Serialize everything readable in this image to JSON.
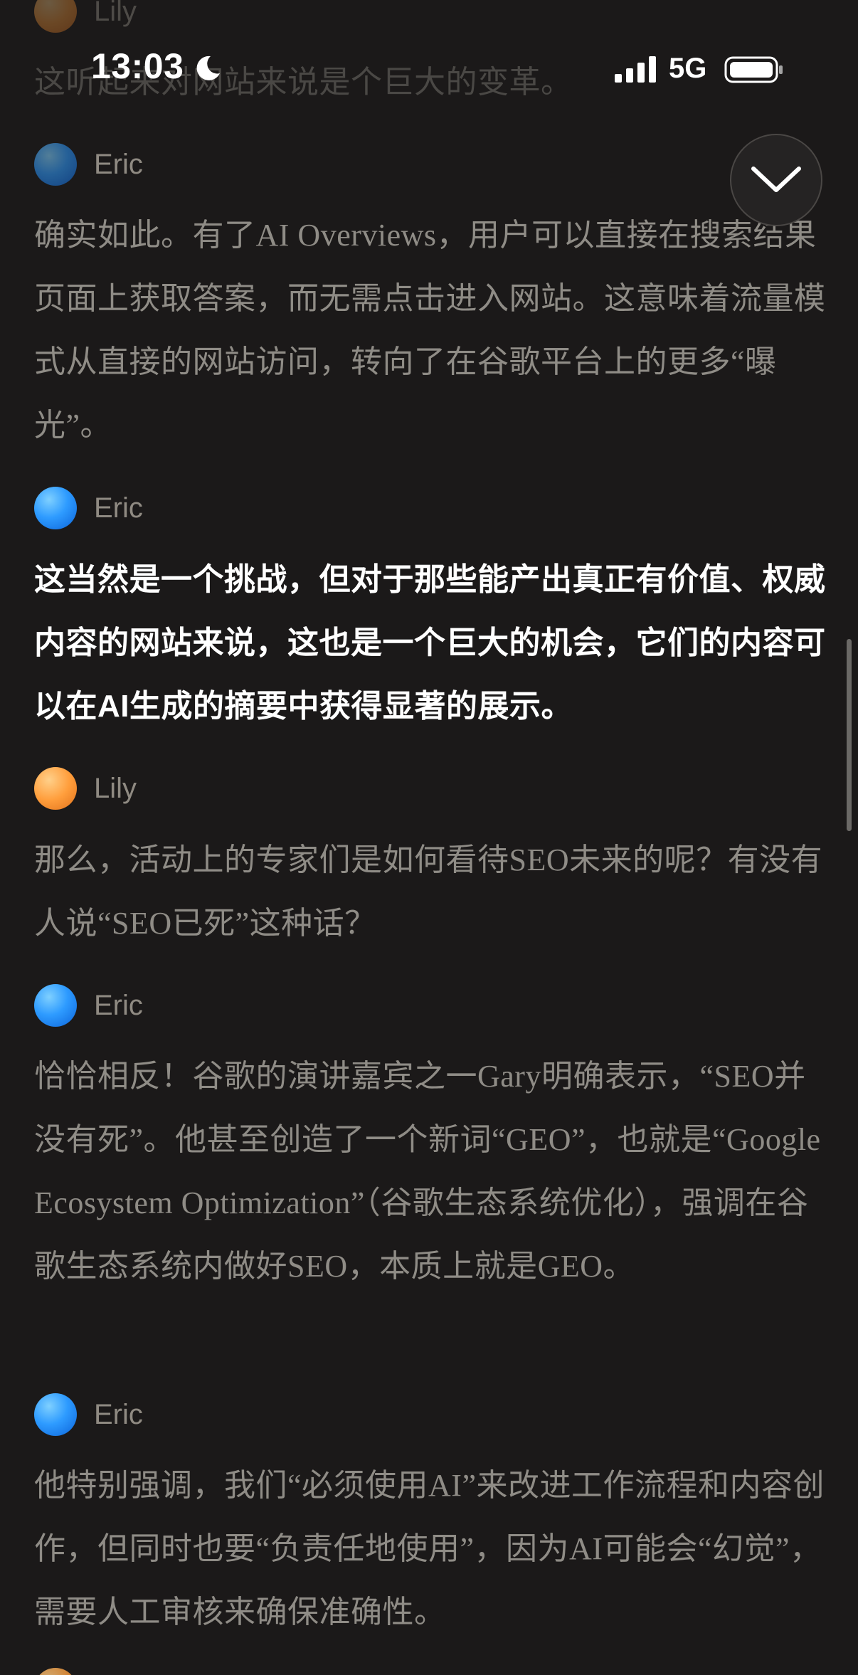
{
  "status_bar": {
    "time": "13:03",
    "network": "5G",
    "icons": [
      "moon-icon",
      "signal-icon",
      "battery-icon"
    ]
  },
  "controls": {
    "scroll_down_icon": "chevron-down-icon"
  },
  "transcript": [
    {
      "speaker": "Lily",
      "text": "这听起来对网站来说是个巨大的变革。",
      "state": "dim"
    },
    {
      "speaker": "Eric",
      "text": "确实如此。有了AI Overviews，用户可以直接在搜索结果页面上获取答案，而无需点击进入网站。这意味着流量模式从直接的网站访问，转向了在谷歌平台上的更多“曝光”。",
      "state": "normal"
    },
    {
      "speaker": "Eric",
      "text": "这当然是一个挑战，但对于那些能产出真正有价值、权威内容的网站来说，这也是一个巨大的机会，它们的内容可以在AI生成的摘要中获得显著的展示。",
      "state": "active"
    },
    {
      "speaker": "Lily",
      "text": "那么，活动上的专家们是如何看待SEO未来的呢？有没有人说“SEO已死”这种话？",
      "state": "normal"
    },
    {
      "speaker": "Eric",
      "text": "恰恰相反！谷歌的演讲嘉宾之一Gary明确表示，“SEO并没有死”。他甚至创造了一个新词“GEO”，也就是“Google Ecosystem Optimization”（谷歌生态系统优化），强调在谷歌生态系统内做好SEO，本质上就是GEO。",
      "state": "normal"
    },
    {
      "speaker": "Eric",
      "text": "他特别强调，我们“必须使用AI”来改进工作流程和内容创作，但同时也要“负责任地使用”，因为AI可能会“幻觉”，需要人工审核来确保准确性。",
      "state": "normal"
    }
  ]
}
